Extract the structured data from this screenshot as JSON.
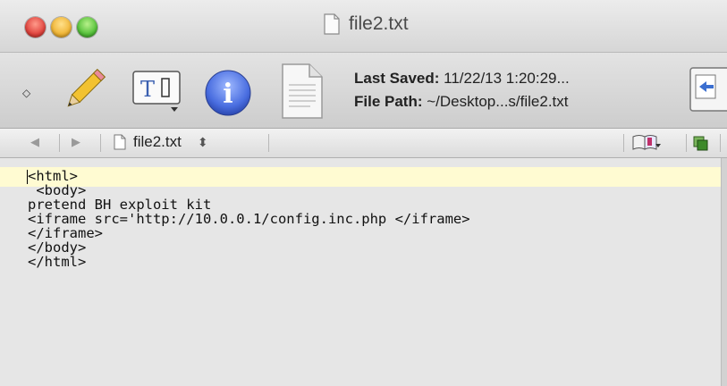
{
  "window": {
    "title": "file2.txt"
  },
  "toolbar": {
    "last_saved_label": "Last Saved:",
    "last_saved_value": " 11/22/13 1:20:29...",
    "file_path_label": "File Path:",
    "file_path_value": " ~/Desktop...s/file2.txt"
  },
  "nav": {
    "back_glyph": "◀",
    "forward_glyph": "▶",
    "file_name": "file2.txt",
    "stepper_glyph": "⬍"
  },
  "editor": {
    "lines": [
      "<html>",
      " <body>",
      "pretend BH exploit kit",
      "<iframe src='http://10.0.0.1/config.inc.php </iframe>",
      "</iframe>",
      "</body>",
      "</html>"
    ]
  },
  "icons": {
    "diamond": "◇",
    "info_letter": "i",
    "text_icon_label": "T"
  }
}
